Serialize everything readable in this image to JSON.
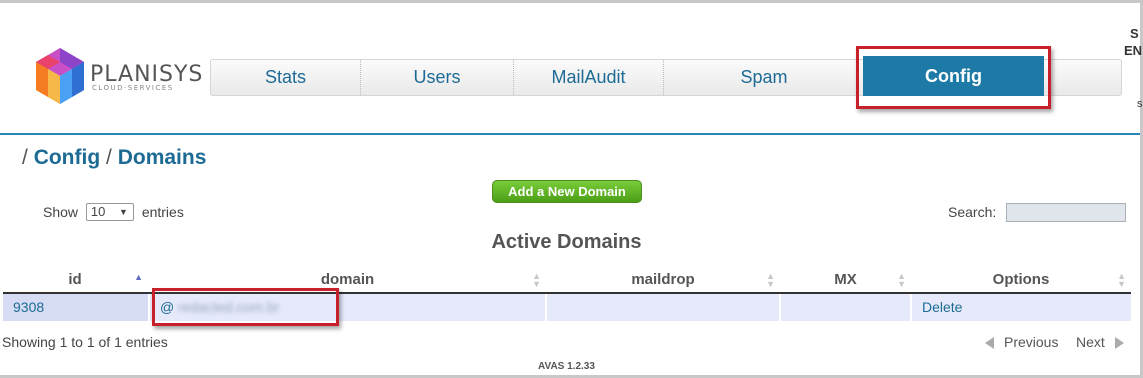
{
  "brand": {
    "name": "PLANISYS",
    "tagline": "CLOUD·SERVICES",
    "colors": {
      "accent": "#1d7aa6",
      "link": "#1d6b95",
      "highlight": "#c8202a",
      "add_button": "#5fb224"
    }
  },
  "header": {
    "corner_text_a": "S",
    "corner_text_b": "EN",
    "corner_text_c": "s"
  },
  "nav": {
    "tabs": [
      {
        "label": "Stats"
      },
      {
        "label": "Users"
      },
      {
        "label": "MailAudit"
      },
      {
        "label": "Spam"
      }
    ],
    "active_tab": {
      "label": "Config"
    }
  },
  "breadcrumb": {
    "separator": "/",
    "items": [
      "Config",
      "Domains"
    ]
  },
  "actions": {
    "add_domain_label": "Add a New Domain"
  },
  "table_controls": {
    "show_label": "Show",
    "page_size": "10",
    "entries_label": "entries",
    "search_label": "Search:",
    "search_value": ""
  },
  "table": {
    "title": "Active Domains",
    "columns": [
      "id",
      "domain",
      "maildrop",
      "MX",
      "Options"
    ],
    "sorted_column": "id",
    "rows": [
      {
        "id": "9308",
        "domain_prefix": "@",
        "domain_redacted": "redacted.com.br",
        "maildrop": "",
        "mx": "",
        "option": "Delete"
      }
    ]
  },
  "pagination": {
    "info": "Showing 1 to 1 of 1 entries",
    "previous": "Previous",
    "next": "Next"
  },
  "footer": {
    "version": "AVAS 1.2.33"
  }
}
